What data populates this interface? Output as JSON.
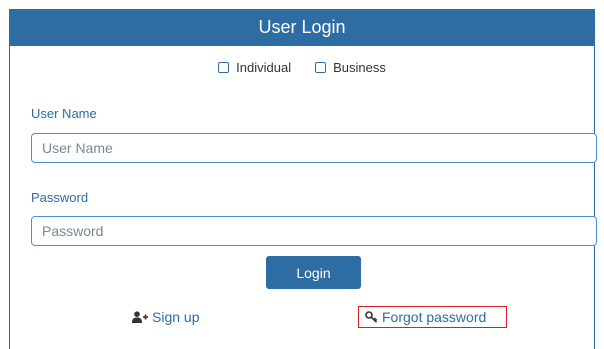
{
  "header": {
    "title": "User Login"
  },
  "account_type": {
    "options": [
      {
        "label": "Individual",
        "checked": false
      },
      {
        "label": "Business",
        "checked": false
      }
    ]
  },
  "username": {
    "label": "User Name",
    "placeholder": "User Name",
    "value": ""
  },
  "password": {
    "label": "Password",
    "placeholder": "Password",
    "value": ""
  },
  "login_button": {
    "label": "Login"
  },
  "links": {
    "signup": {
      "label": "Sign up",
      "icon": "add-user-icon"
    },
    "forgot": {
      "label": "Forgot password",
      "icon": "key-icon"
    }
  },
  "colors": {
    "accent": "#2e6da4",
    "highlight": "#d42020"
  }
}
